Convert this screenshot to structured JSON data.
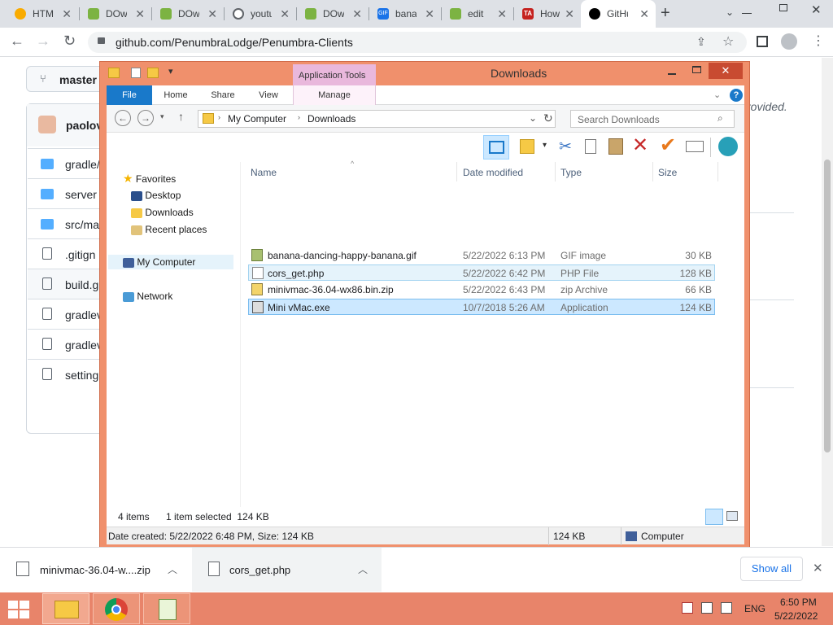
{
  "browser": {
    "tabs": [
      {
        "title": "HTML",
        "icon": "search-icon",
        "color": "#f28b05"
      },
      {
        "title": "DOwn",
        "icon": "puzzle-icon",
        "color": "#6aa84f"
      },
      {
        "title": "DOwn",
        "icon": "puzzle-icon",
        "color": "#6aa84f"
      },
      {
        "title": "youtube",
        "icon": "globe-icon",
        "color": "#5f6368"
      },
      {
        "title": "DOwn",
        "icon": "puzzle-icon",
        "color": "#6aa84f"
      },
      {
        "title": "banana",
        "icon": "gif-icon",
        "color": "#1a73e8"
      },
      {
        "title": "edit",
        "icon": "puzzle-icon",
        "color": "#6aa84f"
      },
      {
        "title": "How",
        "icon": "ta-icon",
        "color": "#c5221f"
      },
      {
        "title": "GitHub",
        "icon": "github-icon",
        "color": "#000000"
      }
    ],
    "url": "github.com/PenumbraLodge/Penumbra-Clients"
  },
  "github": {
    "branch": "master",
    "commit_user": "paolov",
    "provided_text": "rovided.",
    "files": [
      {
        "name": "gradle/",
        "type": "folder"
      },
      {
        "name": "server",
        "type": "folder"
      },
      {
        "name": "src/ma",
        "type": "folder"
      },
      {
        "name": ".gitign",
        "type": "file"
      },
      {
        "name": "build.g",
        "type": "file"
      },
      {
        "name": "gradlev",
        "type": "file"
      },
      {
        "name": "gradlev",
        "type": "file"
      },
      {
        "name": "setting",
        "type": "file"
      }
    ]
  },
  "explorer": {
    "title": "Downloads",
    "context_tab": "Application Tools",
    "ribbon_tabs": [
      "File",
      "Home",
      "Share",
      "View",
      "Manage"
    ],
    "breadcrumb": [
      "My Computer",
      "Downloads"
    ],
    "search_placeholder": "Search Downloads",
    "nav": {
      "favorites": "Favorites",
      "desktop": "Desktop",
      "downloads": "Downloads",
      "recent": "Recent places",
      "computer": "My Computer",
      "network": "Network"
    },
    "columns": {
      "name": "Name",
      "date": "Date modified",
      "type": "Type",
      "size": "Size"
    },
    "files": [
      {
        "name": "banana-dancing-happy-banana.gif",
        "date": "5/22/2022 6:13 PM",
        "type": "GIF image",
        "size": "30 KB"
      },
      {
        "name": "cors_get.php",
        "date": "5/22/2022 6:42 PM",
        "type": "PHP File",
        "size": "128 KB"
      },
      {
        "name": "minivmac-36.04-wx86.bin.zip",
        "date": "5/22/2022 6:43 PM",
        "type": "zip Archive",
        "size": "66 KB"
      },
      {
        "name": "Mini vMac.exe",
        "date": "10/7/2018 5:26 AM",
        "type": "Application",
        "size": "124 KB"
      }
    ],
    "status": {
      "items": "4 items",
      "selected": "1 item selected  124 KB",
      "details": "Date created: 5/22/2022 6:48 PM, Size: 124 KB",
      "size": "124 KB",
      "location": "Computer"
    }
  },
  "downloads_shelf": {
    "items": [
      "minivmac-36.04-w....zip",
      "cors_get.php"
    ],
    "show_all": "Show all"
  },
  "taskbar": {
    "lang": "ENG",
    "time": "6:50 PM",
    "date": "5/22/2022"
  }
}
